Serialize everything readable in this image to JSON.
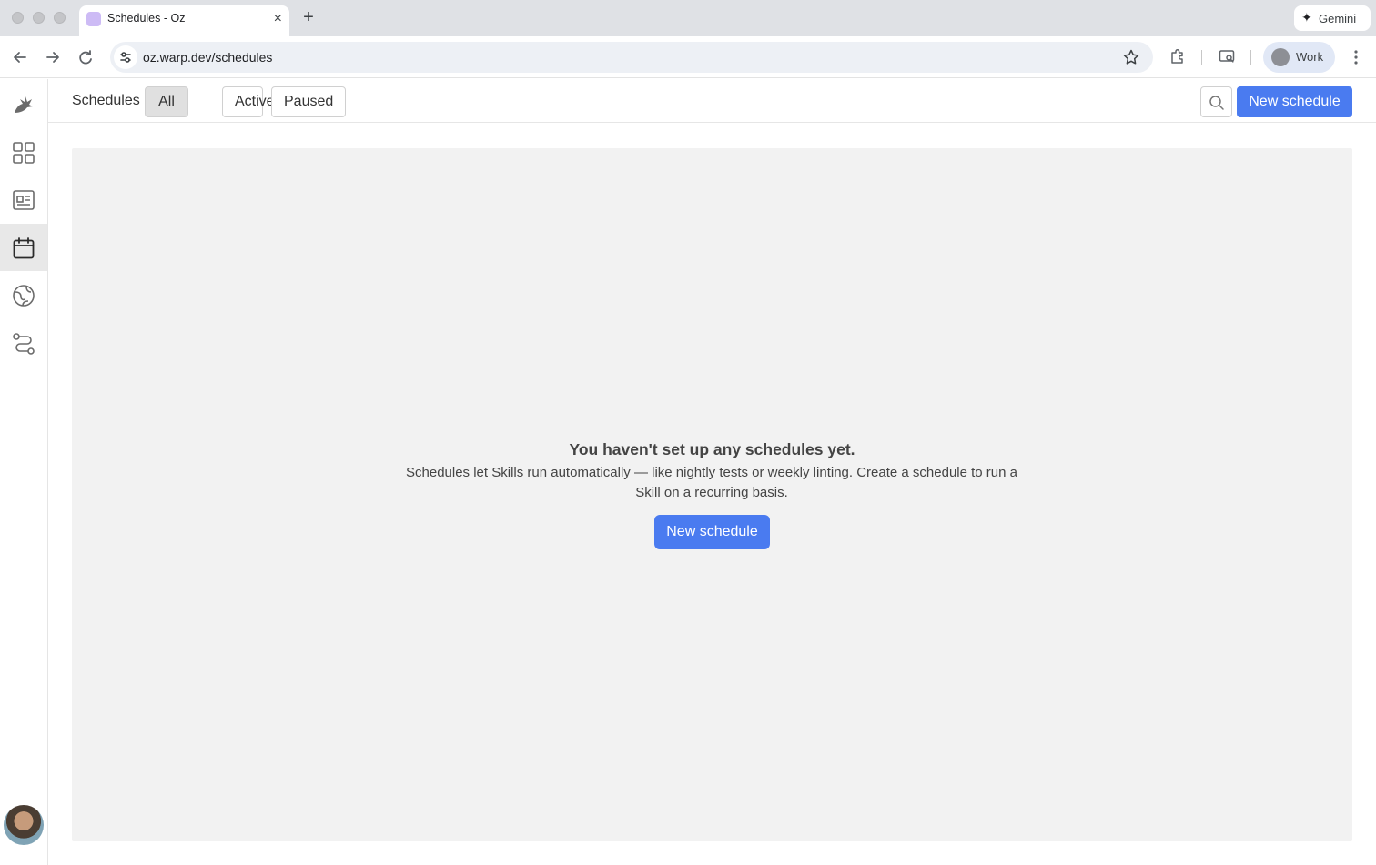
{
  "browser": {
    "tab_title": "Schedules - Oz",
    "tab_close": "×",
    "new_tab": "+",
    "gemini_label": "Gemini",
    "gemini_icon": "✦",
    "url": "oz.warp.dev/schedules",
    "profile_label": "Work"
  },
  "sidebar": {
    "items": [
      {
        "name": "oz-logo-icon"
      },
      {
        "name": "dashboard-grid-icon"
      },
      {
        "name": "skills-icon"
      },
      {
        "name": "calendar-icon",
        "active": true
      },
      {
        "name": "environments-icon"
      },
      {
        "name": "integrations-icon"
      }
    ]
  },
  "header": {
    "title": "Schedules",
    "filters": [
      "All",
      "Active",
      "Paused"
    ],
    "selected_filter": "All",
    "new_schedule_label": "New schedule"
  },
  "empty_state": {
    "title": "You haven't set up any schedules yet.",
    "description": "Schedules let Skills run automatically — like nightly tests or weekly linting. Create a schedule to run a Skill on a recurring basis.",
    "button_label": "New schedule"
  },
  "colors": {
    "accent": "#4a7bf0",
    "panel_bg": "#f2f2f2",
    "active_nav": "#e8e8e8"
  }
}
